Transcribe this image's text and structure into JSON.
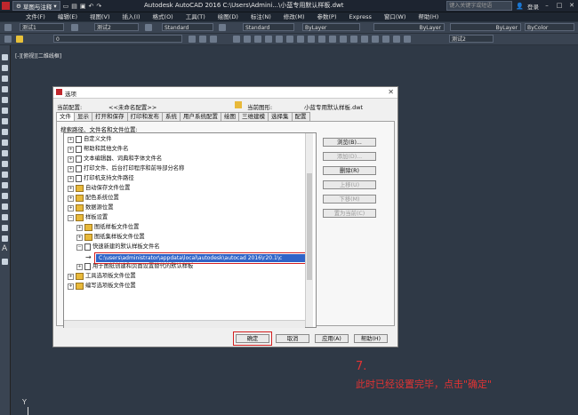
{
  "titlebar": {
    "workspace": "草图与注释",
    "app_title": "Autodesk AutoCAD 2016   C:\\Users\\Admini...\\小蓝专用默认样板.dwt",
    "search_placeholder": "键入关键字或短语",
    "user": "登录"
  },
  "menu": [
    "文件(F)",
    "编辑(E)",
    "视图(V)",
    "插入(I)",
    "格式(O)",
    "工具(T)",
    "绘图(D)",
    "标注(N)",
    "修改(M)",
    "参数(P)",
    "Express",
    "窗口(W)",
    "帮助(H)"
  ],
  "toolbar1": {
    "text_style1": "测试1",
    "text_style2": "测试2",
    "dim_style": "Standard",
    "table_style": "Standard",
    "color": "ByLayer",
    "linetype": "ByLayer",
    "lineweight": "ByLayer",
    "plotstyle": "ByColor"
  },
  "toolbar2": {
    "layer": "0",
    "style": "测试2"
  },
  "viewport_label": "[-][俯视][二维线框]",
  "dialog": {
    "title": "选项",
    "current_profile_label": "当前配置:",
    "current_profile": "<<未命名配置>>",
    "current_drawing_label": "当前图形:",
    "current_drawing": "小蓝专用默认样板.dwt",
    "tabs": [
      "文件",
      "显示",
      "打开和保存",
      "打印和发布",
      "系统",
      "用户系统配置",
      "绘图",
      "三维建模",
      "选择集",
      "配置"
    ],
    "tree_caption": "搜索路径、文件名和文件位置:",
    "tree": [
      {
        "label": "自定义文件",
        "level": 0,
        "icon": "doc"
      },
      {
        "label": "帮助和其他文件名",
        "level": 0,
        "icon": "doc"
      },
      {
        "label": "文本编辑器、词典和字体文件名",
        "level": 0,
        "icon": "doc"
      },
      {
        "label": "打印文件、后台打印程序和前导部分名称",
        "level": 0,
        "icon": "doc"
      },
      {
        "label": "打印机支持文件路径",
        "level": 0,
        "icon": "doc"
      },
      {
        "label": "自动保存文件位置",
        "level": 0,
        "icon": "folder"
      },
      {
        "label": "配色系统位置",
        "level": 0,
        "icon": "folder"
      },
      {
        "label": "数据源位置",
        "level": 0,
        "icon": "folder"
      },
      {
        "label": "样板设置",
        "level": 0,
        "icon": "folder"
      },
      {
        "label": "图纸样板文件位置",
        "level": 1,
        "icon": "folder"
      },
      {
        "label": "图纸集样板文件位置",
        "level": 1,
        "icon": "folder"
      },
      {
        "label": "快速新建的默认样板文件名",
        "level": 1,
        "icon": "doc"
      },
      {
        "label": "用于图纸创建和页面设置替代的默认样板",
        "level": 1,
        "icon": "doc"
      },
      {
        "label": "工具选项板文件位置",
        "level": 0,
        "icon": "folder"
      },
      {
        "label": "编写选项板文件位置",
        "level": 0,
        "icon": "folder"
      }
    ],
    "selected_path": "C:\\users\\administrator\\appdata\\local\\autodesk\\autocad 2016\\r20.1\\c",
    "buttons_right": {
      "browse": "浏览(B)...",
      "add": "添加(D)...",
      "delete": "删除(R)",
      "move_up": "上移(U)",
      "move_down": "下移(M)",
      "set_current": "置为当前(C)"
    },
    "buttons_bottom": {
      "ok": "确定",
      "cancel": "取消",
      "apply": "应用(A)",
      "help": "帮助(H)"
    }
  },
  "annotation": {
    "step": "7.",
    "text": "此时已经设置完毕，点击\"确定\""
  },
  "colors": {
    "annotation_red": "#e23333",
    "selection_blue": "#3064c8",
    "drawing_bg": "#2f3946"
  }
}
